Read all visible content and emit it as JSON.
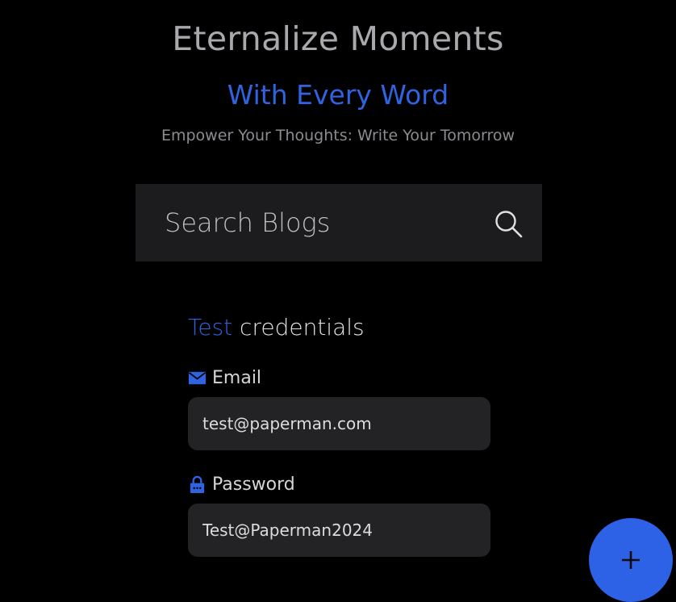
{
  "hero": {
    "title": "Eternalize Moments",
    "subtitle": "With Every Word",
    "tagline": "Empower Your Thoughts: Write Your Tomorrow"
  },
  "search": {
    "placeholder": "Search Blogs",
    "icon": "search-icon"
  },
  "credentials": {
    "heading_accent": "Test",
    "heading_rest": "credentials",
    "email": {
      "label": "Email",
      "icon": "mail-icon",
      "value": "test@paperman.com"
    },
    "password": {
      "label": "Password",
      "icon": "lock-icon",
      "value": "Test@Paperman2024"
    }
  },
  "fab": {
    "icon": "plus-icon"
  },
  "colors": {
    "accent": "#2f63e0",
    "background": "#000000",
    "surface": "#1c1c1f",
    "field": "#232326"
  }
}
